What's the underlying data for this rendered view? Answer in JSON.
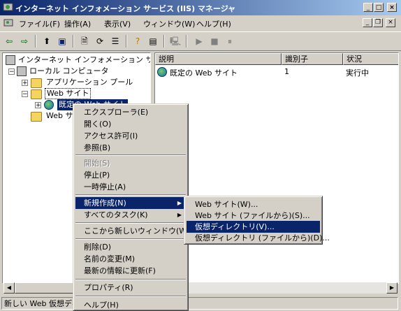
{
  "window": {
    "title": "インターネット インフォメーション サービス (IIS) マネージャ"
  },
  "menubar": {
    "items": [
      "ファイル(F)",
      "操作(A)",
      "表示(V)",
      "ウィンドウ(W)",
      "ヘルプ(H)"
    ]
  },
  "tree": {
    "items": [
      {
        "label": "インターネット インフォメーション サービス"
      },
      {
        "label": "ローカル コンピュータ"
      },
      {
        "label": "アプリケーション プール"
      },
      {
        "label": "Web サイト"
      },
      {
        "label": "既定の Web サイト"
      },
      {
        "label": "Web サ"
      }
    ]
  },
  "list": {
    "columns": [
      "説明",
      "識別子",
      "状況"
    ],
    "rows": [
      {
        "name": "既定の Web サイト",
        "id": "1",
        "status": "実行中"
      }
    ]
  },
  "context_menu": {
    "items": [
      "エクスプローラ(E)",
      "開く(O)",
      "アクセス許可(I)",
      "参照(B)",
      "開始(S)",
      "停止(P)",
      "一時停止(A)",
      "新規作成(N)",
      "すべてのタスク(K)",
      "ここから新しいウィンドウ(W)",
      "削除(D)",
      "名前の変更(M)",
      "最新の情報に更新(F)",
      "プロパティ(R)",
      "ヘルプ(H)"
    ]
  },
  "submenu": {
    "items": [
      "Web サイト(W)...",
      "Web サイト (ファイルから)(S)...",
      "仮想ディレクトリ(V)...",
      "仮想ディレクトリ (ファイルから)(D)..."
    ]
  },
  "statusbar": {
    "text": "新しい Web 仮想ディレ"
  },
  "colors": {
    "title_start": "#0a246a",
    "title_end": "#a6caf0",
    "highlight": "#0a246a",
    "face": "#d4d0c8"
  }
}
